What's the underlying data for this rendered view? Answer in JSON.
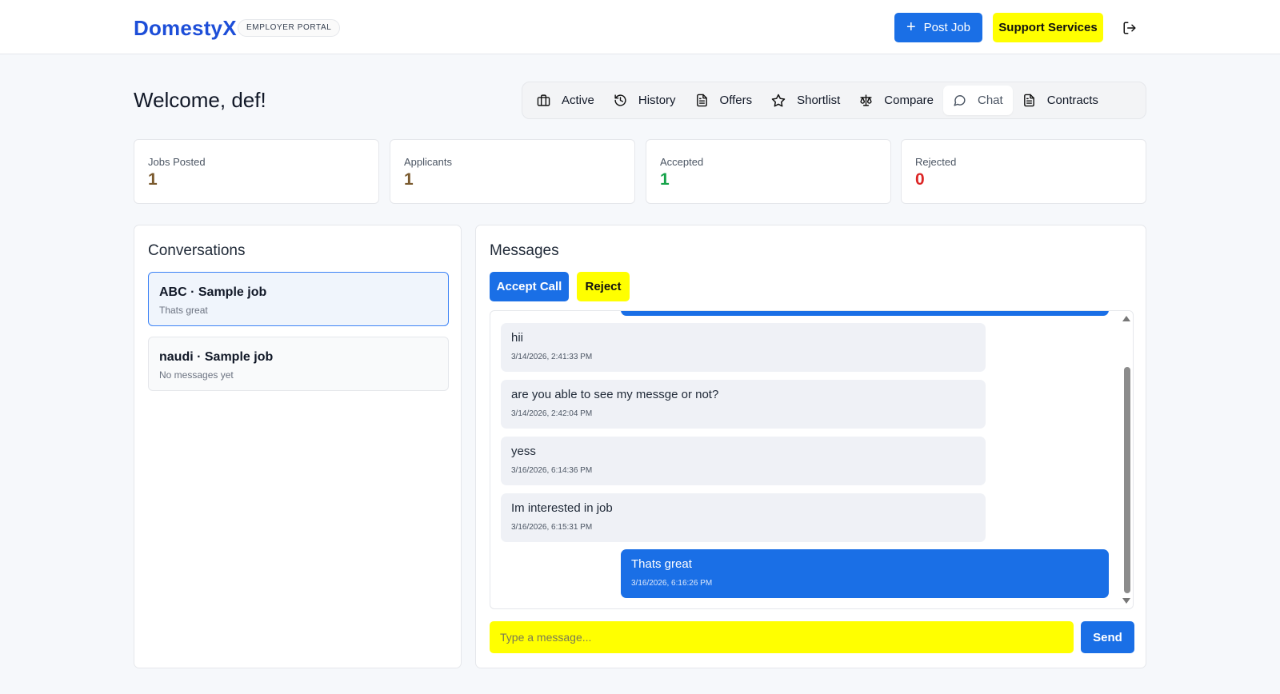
{
  "header": {
    "brand": "DomestyX",
    "portal_badge": "EMPLOYER PORTAL",
    "post_job_label": "Post Job",
    "support_label": "Support Services",
    "logout_icon": "logout-icon"
  },
  "welcome": "Welcome, def!",
  "tabs": [
    {
      "label": "Active",
      "icon": "briefcase-icon"
    },
    {
      "label": "History",
      "icon": "history-icon"
    },
    {
      "label": "Offers",
      "icon": "document-icon"
    },
    {
      "label": "Shortlist",
      "icon": "star-icon"
    },
    {
      "label": "Compare",
      "icon": "scale-icon"
    },
    {
      "label": "Chat",
      "icon": "chat-icon",
      "active": true
    },
    {
      "label": "Contracts",
      "icon": "document-icon"
    }
  ],
  "stats": [
    {
      "label": "Jobs Posted",
      "value": "1",
      "color": "#7a5a2e"
    },
    {
      "label": "Applicants",
      "value": "1",
      "color": "#7a5a2e"
    },
    {
      "label": "Accepted",
      "value": "1",
      "color": "#16a34a"
    },
    {
      "label": "Rejected",
      "value": "0",
      "color": "#dc2626"
    }
  ],
  "conversations": {
    "title": "Conversations",
    "items": [
      {
        "title": "ABC · Sample job",
        "subtitle": "Thats great",
        "active": true
      },
      {
        "title": "naudi · Sample job",
        "subtitle": "No messages yet",
        "active": false
      }
    ]
  },
  "messages": {
    "title": "Messages",
    "accept_label": "Accept Call",
    "reject_label": "Reject",
    "items": [
      {
        "text": "hii",
        "time": "3/14/2026, 2:41:33 PM",
        "direction": "in"
      },
      {
        "text": "are you able to see my messge or not?",
        "time": "3/14/2026, 2:42:04 PM",
        "direction": "in"
      },
      {
        "text": "yess",
        "time": "3/16/2026, 6:14:36 PM",
        "direction": "in"
      },
      {
        "text": "Im interested in job",
        "time": "3/16/2026, 6:15:31 PM",
        "direction": "in"
      },
      {
        "text": "Thats great",
        "time": "3/16/2026, 6:16:26 PM",
        "direction": "out"
      }
    ],
    "input_placeholder": "Type a message...",
    "send_label": "Send"
  },
  "colors": {
    "brand": "#1d4ed8",
    "primary": "#1a6fe6",
    "highlight": "#ffff00"
  }
}
